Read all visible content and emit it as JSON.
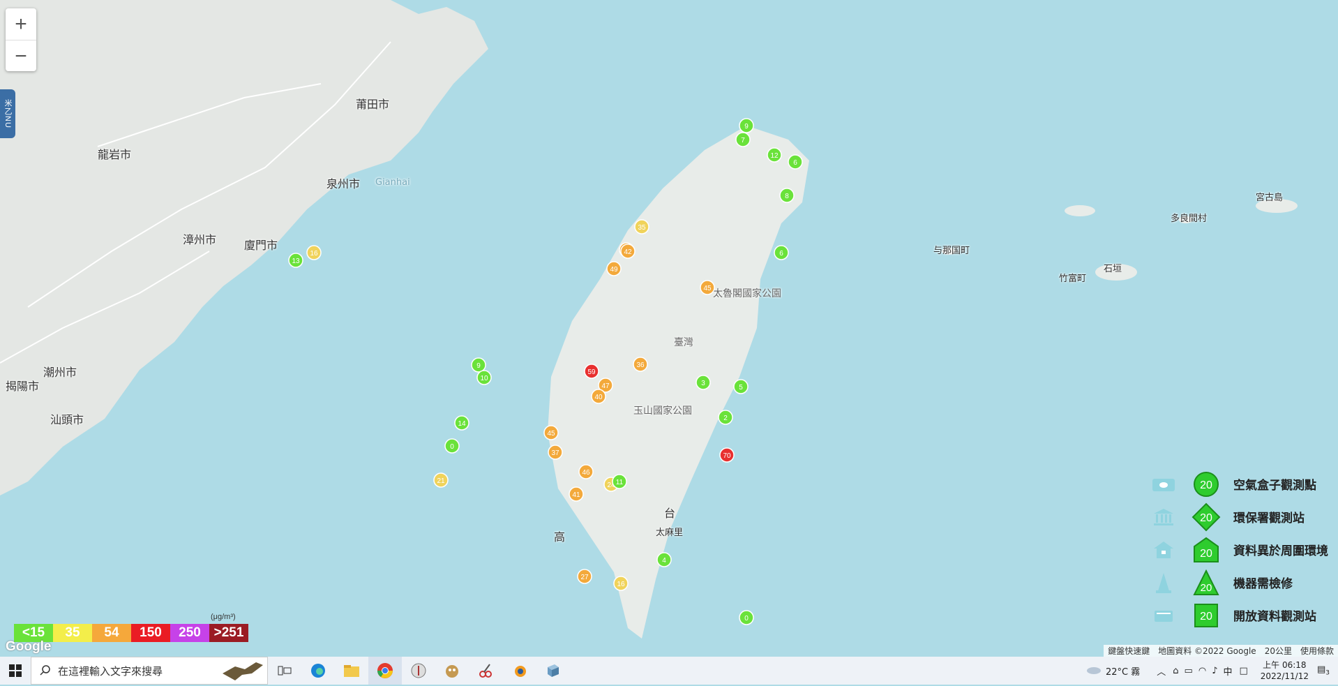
{
  "map": {
    "places": [
      "莆田市",
      "龍岩市",
      "泉州市",
      "漳州市",
      "廈門市",
      "潮州市",
      "揭陽市",
      "汕頭市",
      "宮古島",
      "多良間村",
      "与那国町",
      "竹富町",
      "石垣",
      "Gianhai",
      "太魯閣國家公園",
      "玉山國家公園",
      "臺灣",
      "太麻里",
      "高",
      "台"
    ],
    "markers": [
      {
        "v": "9",
        "c": "#6ae23a"
      },
      {
        "v": "12",
        "c": "#6ae23a"
      },
      {
        "v": "6",
        "c": "#6ae23a"
      },
      {
        "v": "8",
        "c": "#6ae23a"
      },
      {
        "v": "46",
        "c": "#f3a93b"
      },
      {
        "v": "49",
        "c": "#f3a93b"
      },
      {
        "v": "42",
        "c": "#f3a93b"
      },
      {
        "v": "35",
        "c": "#f0d35b"
      },
      {
        "v": "59",
        "c": "#e8302f"
      },
      {
        "v": "47",
        "c": "#f3a93b"
      },
      {
        "v": "40",
        "c": "#f3a93b"
      },
      {
        "v": "36",
        "c": "#f3a93b"
      },
      {
        "v": "45",
        "c": "#f3a93b"
      },
      {
        "v": "37",
        "c": "#f3a93b"
      },
      {
        "v": "41",
        "c": "#f3a93b"
      },
      {
        "v": "46",
        "c": "#f3a93b"
      },
      {
        "v": "24",
        "c": "#f0d35b"
      },
      {
        "v": "27",
        "c": "#f3a93b"
      },
      {
        "v": "16",
        "c": "#f0d35b"
      },
      {
        "v": "70",
        "c": "#e8302f"
      },
      {
        "v": "45",
        "c": "#f3a93b"
      },
      {
        "v": "9",
        "c": "#6ae23a"
      },
      {
        "v": "10",
        "c": "#6ae23a"
      },
      {
        "v": "14",
        "c": "#6ae23a"
      },
      {
        "v": "0",
        "c": "#6ae23a"
      },
      {
        "v": "21",
        "c": "#f0d35b"
      },
      {
        "v": "13",
        "c": "#6ae23a"
      },
      {
        "v": "16",
        "c": "#f0d35b"
      },
      {
        "v": "0",
        "c": "#6ae23a"
      },
      {
        "v": "4",
        "c": "#6ae23a"
      },
      {
        "v": "5",
        "c": "#6ae23a"
      },
      {
        "v": "3",
        "c": "#6ae23a"
      },
      {
        "v": "2",
        "c": "#6ae23a"
      },
      {
        "v": "11",
        "c": "#6ae23a"
      },
      {
        "v": "6",
        "c": "#6ae23a"
      },
      {
        "v": "7",
        "c": "#6ae23a"
      }
    ]
  },
  "zoom": {
    "in": "+",
    "out": "−"
  },
  "menu_tab": "米乙NU",
  "aqi_scale": {
    "unit": "(μg/m³)",
    "levels": [
      {
        "label": "<15",
        "color": "#6ae23a"
      },
      {
        "label": "35",
        "color": "#f3ee4a"
      },
      {
        "label": "54",
        "color": "#f5a83b"
      },
      {
        "label": "150",
        "color": "#ea1c24"
      },
      {
        "label": "250",
        "color": "#c642e8"
      },
      {
        "label": ">251",
        "color": "#9b1c24"
      }
    ]
  },
  "symbol_legend": [
    {
      "label": "空氣盒子觀測點",
      "value": "20",
      "shape": "circle",
      "icon": "cloud-box-icon"
    },
    {
      "label": "環保署觀測站",
      "value": "20",
      "shape": "diamond",
      "icon": "government-building-icon"
    },
    {
      "label": "資料異於周圍環境",
      "value": "20",
      "shape": "house",
      "icon": "house-icon"
    },
    {
      "label": "機器需檢修",
      "value": "20",
      "shape": "triangle",
      "icon": "traffic-cone-icon"
    },
    {
      "label": "開放資料觀測站",
      "value": "20",
      "shape": "square",
      "icon": "data-box-icon"
    }
  ],
  "google": "Google",
  "attribution": [
    "鍵盤快速鍵",
    "地圖資料 ©2022 Google",
    "20公里",
    "使用條款"
  ],
  "taskbar": {
    "search_placeholder": "在這裡輸入文字來搜尋",
    "weather": "22°C 霧",
    "ime": "中",
    "time": "上午 06:18",
    "date": "2022/11/12",
    "notif_count": "3"
  }
}
